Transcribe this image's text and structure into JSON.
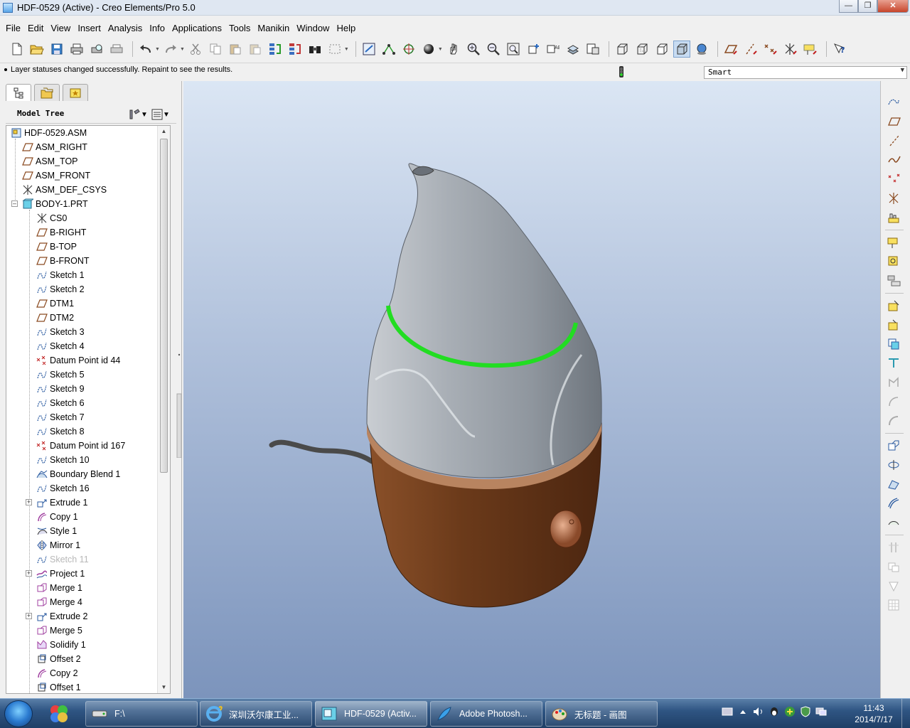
{
  "window": {
    "title": "HDF-0529 (Active) - Creo Elements/Pro 5.0",
    "controls": [
      "minimize",
      "maximize",
      "close"
    ]
  },
  "menu": [
    "File",
    "Edit",
    "View",
    "Insert",
    "Analysis",
    "Info",
    "Applications",
    "Tools",
    "Manikin",
    "Window",
    "Help"
  ],
  "toolbar": {
    "icons": [
      "new-file-icon",
      "open-file-icon",
      "save-icon",
      "print-icon",
      "print-preview-icon",
      "print-setup-icon",
      "undo-icon",
      "redo-icon",
      "cut-icon",
      "copy-icon",
      "paste-icon",
      "paste-special-icon",
      "regenerate-icon",
      "regen-manager-icon",
      "find-icon",
      "select-box-icon",
      "refit-icon",
      "datum-display-icon",
      "spin-center-icon",
      "shading-icon",
      "pan-icon",
      "zoom-in-icon",
      "zoom-out-icon",
      "zoom-fit-icon",
      "reorient-icon",
      "saved-views-icon",
      "layers-icon",
      "view-manager-icon",
      "wireframe-icon",
      "hidden-line-icon",
      "no-hidden-icon",
      "shaded-icon",
      "enhanced-realism-icon",
      "datum-planes-toggle-icon",
      "datum-axes-toggle-icon",
      "datum-points-toggle-icon",
      "csys-toggle-icon",
      "annotations-toggle-icon",
      "context-help-icon"
    ]
  },
  "message": {
    "text": "Layer statuses changed successfully. Repaint to see the results."
  },
  "filter": {
    "value": "Smart"
  },
  "model_tree": {
    "title": "Model Tree",
    "items": [
      {
        "label": "HDF-0529.ASM",
        "icon": "assembly-icon",
        "indent": 0,
        "expander": "",
        "dim": false
      },
      {
        "label": "ASM_RIGHT",
        "icon": "datum-plane-icon",
        "indent": 1,
        "expander": "",
        "dim": false
      },
      {
        "label": "ASM_TOP",
        "icon": "datum-plane-icon",
        "indent": 1,
        "expander": "",
        "dim": false
      },
      {
        "label": "ASM_FRONT",
        "icon": "datum-plane-icon",
        "indent": 1,
        "expander": "",
        "dim": false
      },
      {
        "label": "ASM_DEF_CSYS",
        "icon": "csys-icon",
        "indent": 1,
        "expander": "",
        "dim": false
      },
      {
        "label": "BODY-1.PRT",
        "icon": "part-icon",
        "indent": 1,
        "expander": "-",
        "dim": false
      },
      {
        "label": "CS0",
        "icon": "csys-icon",
        "indent": 2,
        "expander": "",
        "dim": false
      },
      {
        "label": "B-RIGHT",
        "icon": "datum-plane-icon",
        "indent": 2,
        "expander": "",
        "dim": false
      },
      {
        "label": "B-TOP",
        "icon": "datum-plane-icon",
        "indent": 2,
        "expander": "",
        "dim": false
      },
      {
        "label": "B-FRONT",
        "icon": "datum-plane-icon",
        "indent": 2,
        "expander": "",
        "dim": false
      },
      {
        "label": "Sketch 1",
        "icon": "sketch-icon",
        "indent": 2,
        "expander": "",
        "dim": false
      },
      {
        "label": "Sketch 2",
        "icon": "sketch-icon",
        "indent": 2,
        "expander": "",
        "dim": false
      },
      {
        "label": "DTM1",
        "icon": "datum-plane-icon",
        "indent": 2,
        "expander": "",
        "dim": false
      },
      {
        "label": "DTM2",
        "icon": "datum-plane-icon",
        "indent": 2,
        "expander": "",
        "dim": false
      },
      {
        "label": "Sketch 3",
        "icon": "sketch-icon",
        "indent": 2,
        "expander": "",
        "dim": false
      },
      {
        "label": "Sketch 4",
        "icon": "sketch-icon",
        "indent": 2,
        "expander": "",
        "dim": false
      },
      {
        "label": "Datum Point id 44",
        "icon": "datum-point-icon",
        "indent": 2,
        "expander": "",
        "dim": false
      },
      {
        "label": "Sketch 5",
        "icon": "sketch-icon",
        "indent": 2,
        "expander": "",
        "dim": false
      },
      {
        "label": "Sketch 9",
        "icon": "sketch-icon",
        "indent": 2,
        "expander": "",
        "dim": false
      },
      {
        "label": "Sketch 6",
        "icon": "sketch-icon",
        "indent": 2,
        "expander": "",
        "dim": false
      },
      {
        "label": "Sketch 7",
        "icon": "sketch-icon",
        "indent": 2,
        "expander": "",
        "dim": false
      },
      {
        "label": "Sketch 8",
        "icon": "sketch-icon",
        "indent": 2,
        "expander": "",
        "dim": false
      },
      {
        "label": "Datum Point id 167",
        "icon": "datum-point-icon",
        "indent": 2,
        "expander": "",
        "dim": false
      },
      {
        "label": "Sketch 10",
        "icon": "sketch-icon",
        "indent": 2,
        "expander": "",
        "dim": false
      },
      {
        "label": "Boundary Blend 1",
        "icon": "boundary-blend-icon",
        "indent": 2,
        "expander": "",
        "dim": false
      },
      {
        "label": "Sketch 16",
        "icon": "sketch-icon",
        "indent": 2,
        "expander": "",
        "dim": false
      },
      {
        "label": "Extrude 1",
        "icon": "extrude-icon",
        "indent": 2,
        "expander": "+",
        "dim": false
      },
      {
        "label": "Copy 1",
        "icon": "copy-feature-icon",
        "indent": 2,
        "expander": "",
        "dim": false
      },
      {
        "label": "Style 1",
        "icon": "style-icon",
        "indent": 2,
        "expander": "",
        "dim": false
      },
      {
        "label": "Mirror 1",
        "icon": "mirror-icon",
        "indent": 2,
        "expander": "",
        "dim": false
      },
      {
        "label": "Sketch 11",
        "icon": "sketch-icon",
        "indent": 2,
        "expander": "",
        "dim": true
      },
      {
        "label": "Project 1",
        "icon": "project-icon",
        "indent": 2,
        "expander": "+",
        "dim": false
      },
      {
        "label": "Merge 1",
        "icon": "merge-icon",
        "indent": 2,
        "expander": "",
        "dim": false
      },
      {
        "label": "Merge 4",
        "icon": "merge-icon",
        "indent": 2,
        "expander": "",
        "dim": false
      },
      {
        "label": "Extrude 2",
        "icon": "extrude-icon",
        "indent": 2,
        "expander": "+",
        "dim": false
      },
      {
        "label": "Merge 5",
        "icon": "merge-icon",
        "indent": 2,
        "expander": "",
        "dim": false
      },
      {
        "label": "Solidify 1",
        "icon": "solidify-icon",
        "indent": 2,
        "expander": "",
        "dim": false
      },
      {
        "label": "Offset 2",
        "icon": "offset-icon",
        "indent": 2,
        "expander": "",
        "dim": false
      },
      {
        "label": "Copy 2",
        "icon": "copy-feature-icon",
        "indent": 2,
        "expander": "",
        "dim": false
      },
      {
        "label": "Offset 1",
        "icon": "offset-icon",
        "indent": 2,
        "expander": "",
        "dim": false
      }
    ]
  },
  "right_toolbar": {
    "icons": [
      "datum-curve-sketch-icon",
      "datum-plane-icon",
      "datum-axis-icon",
      "datum-curve-icon",
      "datum-point-icon",
      "datum-csys-icon",
      "analysis-feature-icon",
      "annotation-feature-icon",
      "copy-geometry-icon",
      "shrinkwrap-icon",
      "publish-geometry-icon",
      "merge-tool-icon",
      "trim-icon",
      "intersect-icon",
      "extend-icon",
      "offset-tool-icon",
      "thicken-icon",
      "solidify-tool-icon",
      "wrap-icon",
      "blend-surface-icon",
      "mirror-tool-icon",
      "fill-icon",
      "boundary-icon",
      "style-tool-icon",
      "sweep-icon",
      "variable-sweep-icon",
      "pattern-icon",
      "component-icon",
      "datum-grid-icon"
    ]
  },
  "colors": {
    "accent_selection": "#22dd22",
    "model_top": "#9aa2aa",
    "model_base": "#6b3b1c",
    "background_top": "#dbe6f4",
    "background_bottom": "#7c94bc"
  },
  "taskbar": {
    "tasks": [
      {
        "label": "F:\\",
        "icon": "drive-icon"
      },
      {
        "label": "深圳沃尔康工业...",
        "icon": "ie-icon"
      },
      {
        "label": "HDF-0529 (Activ...",
        "icon": "creo-icon"
      },
      {
        "label": "Adobe Photosh...",
        "icon": "photoshop-icon"
      },
      {
        "label": "无标题 - 画图",
        "icon": "paint-icon"
      }
    ],
    "time": "11:43",
    "date": "2014/7/17"
  }
}
